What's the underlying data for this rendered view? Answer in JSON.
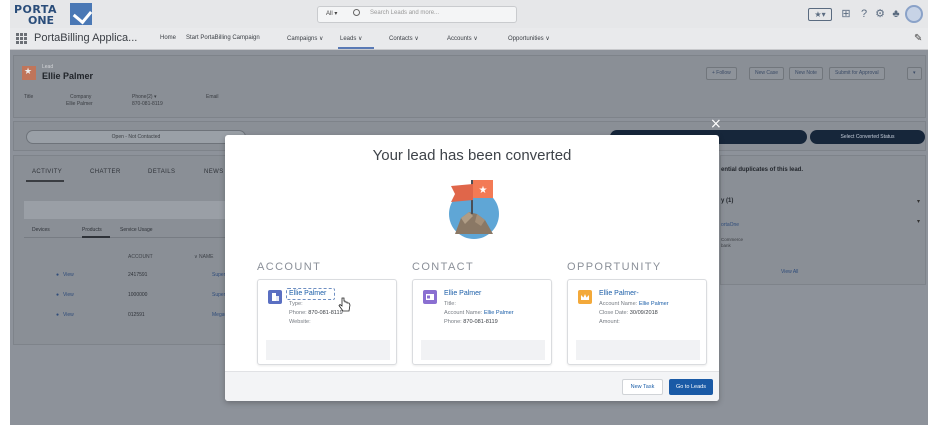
{
  "header": {
    "logo_line1": "PORTA",
    "logo_line2": "ONE",
    "search_scope": "All ▾",
    "search_placeholder": "Search Leads and more...",
    "icons": [
      "favorites-icon",
      "add-icon",
      "help-icon",
      "setup-icon",
      "notifications-icon",
      "avatar"
    ]
  },
  "nav": {
    "app_name": "PortaBilling Applica...",
    "items": [
      "Home",
      "Start PortaBilling Campaign",
      "Campaigns ∨",
      "Leads ∨",
      "Contacts ∨",
      "Accounts ∨",
      "Opportunities ∨"
    ],
    "active_item": "Leads"
  },
  "lead": {
    "type_label": "Lead",
    "name": "Ellie Palmer",
    "actions": [
      "+ Follow",
      "New Case",
      "New Note",
      "Submit for Approval",
      "▾"
    ],
    "fields": [
      {
        "label": "Title",
        "value": ""
      },
      {
        "label": "Company",
        "value": "Ellie Palmer"
      },
      {
        "label": "Phone(2) ▾",
        "value": "870-081-8119"
      },
      {
        "label": "Email",
        "value": ""
      }
    ]
  },
  "path": {
    "stage": "Open - Not Contacted",
    "select_status": "Select Converted Status"
  },
  "main_tabs": [
    "ACTIVITY",
    "CHATTER",
    "DETAILS",
    "NEWS"
  ],
  "sub_tabs": [
    "Devices",
    "Products",
    "Service Usage"
  ],
  "table": {
    "headers": [
      "ACCOUNT",
      "∨ NAME"
    ],
    "rows": [
      {
        "action": "View",
        "account": "2417591",
        "name": "SuperCa"
      },
      {
        "action": "View",
        "account": "1000000",
        "name": "SuperCa"
      },
      {
        "action": "View",
        "account": "012591",
        "name": "MegaCa"
      }
    ]
  },
  "right_panel": {
    "duplicates_text": "ential duplicates of this lead.",
    "count_label": "y (1)",
    "link": "ortaOne",
    "sub_line1": "Commerce",
    "sub_line2": "bank",
    "view_all": "View All"
  },
  "modal": {
    "title": "Your lead has been converted",
    "close": "×",
    "columns": [
      "ACCOUNT",
      "CONTACT",
      "OPPORTUNITY"
    ],
    "account": {
      "name": "Ellie Palmer",
      "type_label": "Type:",
      "type_value": "",
      "phone_label": "Phone:",
      "phone_value": "870-081-8119",
      "website_label": "Website:",
      "website_value": ""
    },
    "contact": {
      "name": "Ellie Palmer",
      "title_label": "Title:",
      "title_value": "",
      "account_label": "Account Name:",
      "account_value": "Ellie Palmer",
      "phone_label": "Phone:",
      "phone_value": "870-081-8119"
    },
    "opportunity": {
      "name": "Ellie Palmer-",
      "account_label": "Account Name:",
      "account_value": "Ellie Palmer",
      "close_label": "Close Date:",
      "close_value": "30/09/2018",
      "amount_label": "Amount:",
      "amount_value": ""
    },
    "new_task": "New Task",
    "go_to_leads": "Go to Leads"
  },
  "colors": {
    "brand_blue": "#1a5aa6",
    "link_blue": "#1b5ea8",
    "overlay_grey": "#8d929a",
    "account_icon": "#5a6fc2",
    "contact_icon": "#8a6fd1",
    "opportunity_icon": "#f3a93a",
    "lead_icon": "#e0664a",
    "flag_orange": "#f37a55"
  }
}
